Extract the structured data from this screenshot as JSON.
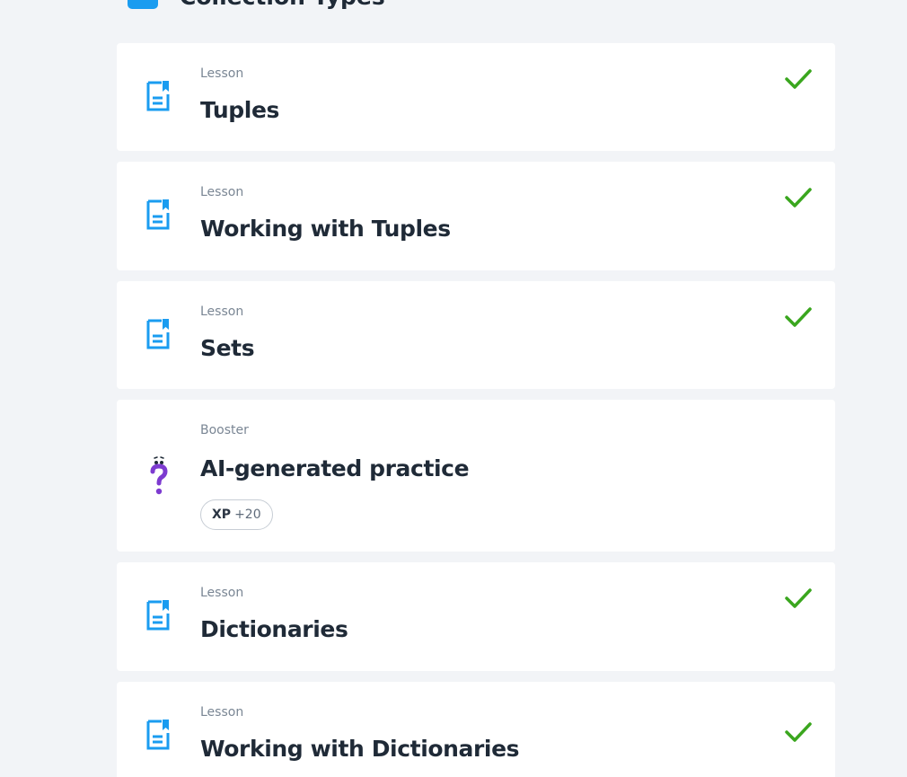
{
  "section": {
    "title": "Collection Types"
  },
  "cards": [
    {
      "type": "Lesson",
      "title": "Tuples",
      "icon": "lesson-document-icon",
      "completed": true
    },
    {
      "type": "Lesson",
      "title": "Working with Tuples",
      "icon": "lesson-document-icon",
      "completed": true
    },
    {
      "type": "Lesson",
      "title": "Sets",
      "icon": "lesson-document-icon",
      "completed": true
    },
    {
      "type": "Booster",
      "title": "AI-generated practice",
      "icon": "question-mark-icon",
      "completed": false,
      "xp_label": "XP",
      "xp_value": "+20"
    },
    {
      "type": "Lesson",
      "title": "Dictionaries",
      "icon": "lesson-document-icon",
      "completed": true
    },
    {
      "type": "Lesson",
      "title": "Working with Dictionaries",
      "icon": "lesson-document-icon",
      "completed": true
    }
  ],
  "colors": {
    "accent_blue": "#1a9cf0",
    "check_green": "#3aa61e",
    "booster_purple": "#7d3bd0"
  }
}
